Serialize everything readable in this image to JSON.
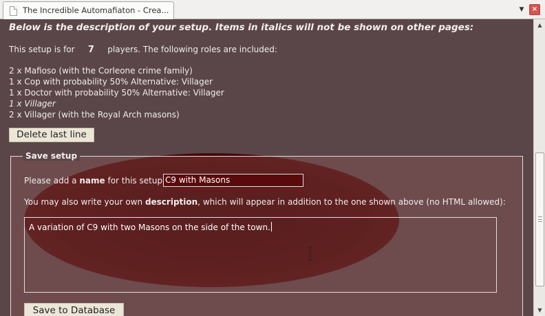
{
  "browser": {
    "tab_title": "The Incredible Automafiaton - Crea...",
    "list_tabs_icon": "chevron-down-icon",
    "close_icon": "close-icon",
    "close_glyph": "×"
  },
  "page": {
    "heading": "Below is the description of your setup. Items in italics will not be shown on other pages:",
    "players_prefix": "This setup is for",
    "players_count": "7",
    "players_suffix": "players. The following roles are included:",
    "roles": [
      {
        "text": "2 x Mafioso (with the Corleone crime family)",
        "italic": false
      },
      {
        "text": "1 x Cop with probability 50% Alternative: Villager",
        "italic": false
      },
      {
        "text": "1 x Doctor with probability 50% Alternative: Villager",
        "italic": false
      },
      {
        "text": "1 x Villager",
        "italic": true
      },
      {
        "text": "2 x Villager (with the Royal Arch masons)",
        "italic": false
      }
    ],
    "delete_button": "Delete last line",
    "save_setup": {
      "legend": "Save setup",
      "name_label_pre": "Please add a",
      "name_label_bold": "name",
      "name_label_post": "for this setup:",
      "name_value": "C9 with Masons",
      "desc_label_pre": "You may also write your own",
      "desc_label_bold": "description",
      "desc_label_post": ", which will appear in addition to the one shown above (no HTML allowed):",
      "desc_value": "A variation of C9 with two Masons on the side of the town.",
      "save_button": "Save to Database"
    }
  },
  "colors": {
    "page_bg": "#5a4648",
    "stain": "#3a0000",
    "button_bg": "#ece6d8"
  }
}
